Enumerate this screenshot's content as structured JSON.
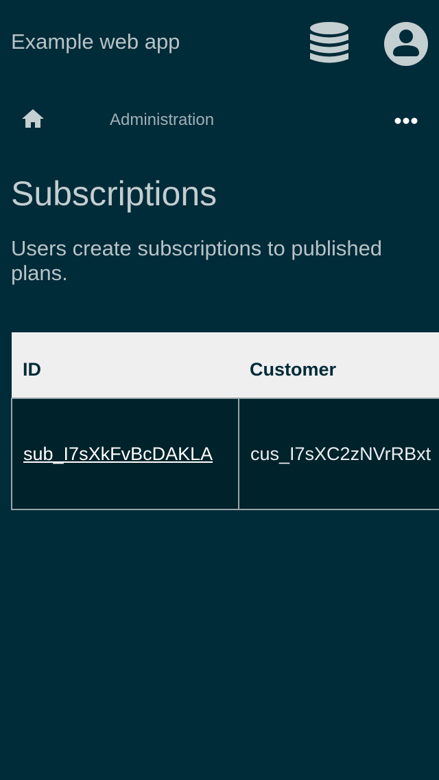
{
  "app": {
    "title": "Example web app"
  },
  "header": {
    "database_icon": "database-icon",
    "account_icon": "account-circle-icon"
  },
  "nav": {
    "home_icon": "home-icon",
    "breadcrumb": "Administration",
    "more_icon": "more-horizontal-icon"
  },
  "main": {
    "title": "Subscriptions",
    "description": "Users create subscriptions to published plans."
  },
  "table": {
    "columns": [
      "ID",
      "Customer"
    ],
    "rows": [
      {
        "id": "sub_I7sXkFvBcDAKLA",
        "customer": "cus_I7sXC2zNVrRBxt"
      }
    ]
  },
  "colors": {
    "background": "#002b38",
    "table_header_bg": "#efefef",
    "table_cell_bg": "#00222b",
    "text_muted": "#b7c3c7"
  }
}
